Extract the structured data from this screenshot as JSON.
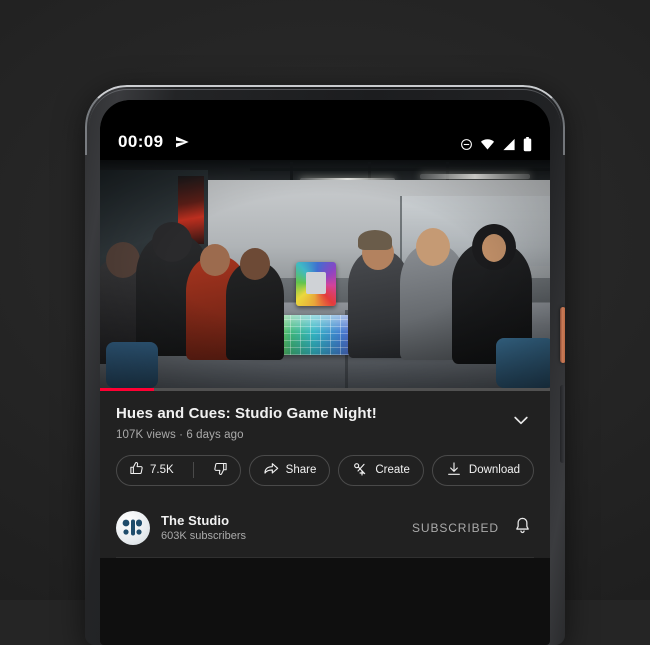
{
  "device": {
    "name": "pixel-phone",
    "power_button_color": "#c97a57",
    "body_color": "#232426"
  },
  "status_bar": {
    "clock": "00:09",
    "left_icons": [
      "send-icon"
    ],
    "right_icons": [
      "do-not-disturb-icon",
      "wifi-icon",
      "cellular-signal-icon",
      "battery-icon"
    ]
  },
  "player": {
    "progress_percent": 12,
    "progress_color": "#ff0033",
    "scene_description": "people seated around a long gray table playing a colorful rainbow board game in an office studio"
  },
  "video": {
    "title": "Hues and Cues: Studio Game Night!",
    "meta": "107K views · 6 days ago",
    "expand_icon": "chevron-down-icon"
  },
  "actions": {
    "like": {
      "icon": "thumbs-up-icon",
      "label": "7.5K"
    },
    "dislike": {
      "icon": "thumbs-down-icon",
      "label": ""
    },
    "share": {
      "icon": "share-arrow-icon",
      "label": "Share"
    },
    "create": {
      "icon": "create-clip-icon",
      "label": "Create"
    },
    "download": {
      "icon": "download-icon",
      "label": "Download"
    },
    "save": {
      "icon": "save-to-playlist-icon",
      "label": ""
    }
  },
  "channel": {
    "name": "The Studio",
    "subscribers": "603K subscribers",
    "subscribe_state": "SUBSCRIBED",
    "bell_icon": "notification-bell-icon",
    "avatar_icon": "studio-logo-avatar"
  }
}
